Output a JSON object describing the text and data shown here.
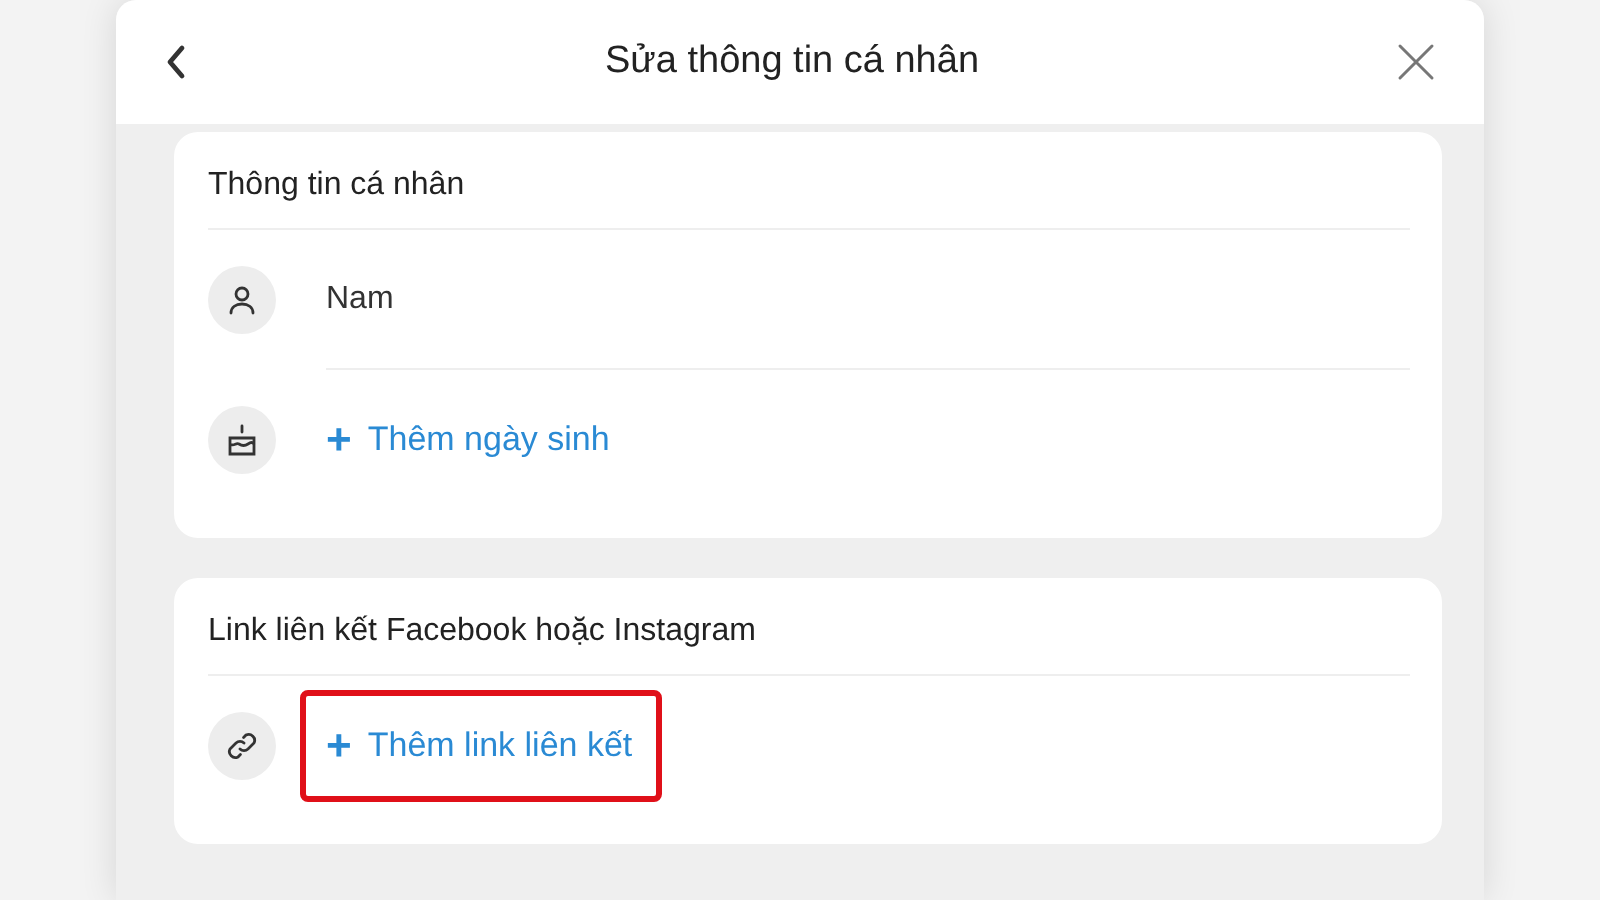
{
  "dialog": {
    "title": "Sửa thông tin cá nhân"
  },
  "sections": [
    {
      "title": "Thông tin cá nhân",
      "rows": [
        {
          "kind": "gender",
          "text": "Nam"
        },
        {
          "kind": "birthday",
          "plus": "+",
          "text": "Thêm ngày sinh"
        }
      ]
    },
    {
      "title": "Link liên kết Facebook hoặc Instagram",
      "rows": [
        {
          "kind": "link",
          "plus": "+",
          "text": "Thêm link liên kết",
          "highlighted": true
        }
      ]
    }
  ]
}
